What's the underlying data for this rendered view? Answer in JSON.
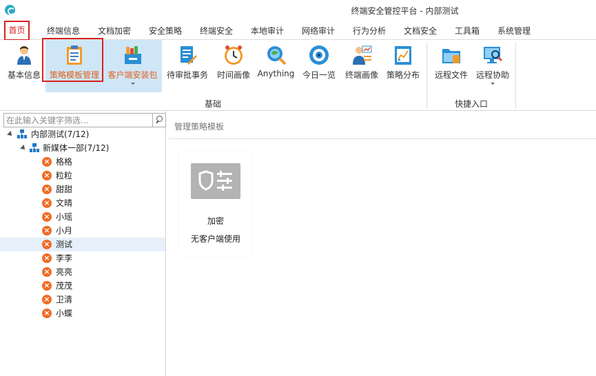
{
  "window": {
    "title": "终端安全管控平台 - 内部测试"
  },
  "menu": {
    "tabs": [
      {
        "label": "首页"
      },
      {
        "label": "终端信息"
      },
      {
        "label": "文档加密"
      },
      {
        "label": "安全策略"
      },
      {
        "label": "终端安全"
      },
      {
        "label": "本地审计"
      },
      {
        "label": "网络审计"
      },
      {
        "label": "行为分析"
      },
      {
        "label": "文档安全"
      },
      {
        "label": "工具箱"
      },
      {
        "label": "系统管理"
      }
    ]
  },
  "ribbon": {
    "buttons": [
      {
        "label": "基本信息",
        "icon": "user-icon"
      },
      {
        "label": "策略模板管理",
        "icon": "clipboard-icon"
      },
      {
        "label": "客户端安装包",
        "icon": "package-icon"
      },
      {
        "label": "待审批事务",
        "icon": "approval-icon"
      },
      {
        "label": "时间画像",
        "icon": "clock-icon"
      },
      {
        "label": "Anything",
        "icon": "search-globe-icon"
      },
      {
        "label": "今日一览",
        "icon": "eye-icon"
      },
      {
        "label": "终端画像",
        "icon": "terminal-profile-icon"
      },
      {
        "label": "策略分布",
        "icon": "chart-icon"
      },
      {
        "label": "远程文件",
        "icon": "folder-icon"
      },
      {
        "label": "远程协助",
        "icon": "remote-assist-icon"
      }
    ],
    "groups": {
      "basic": "基础",
      "quick": "快捷入口"
    }
  },
  "search": {
    "placeholder": "在此输入关键字筛选..."
  },
  "tree": {
    "root": "内部测试(7/12)",
    "dept": "新媒体一部(7/12)",
    "users": [
      "格格",
      "粒粒",
      "甜甜",
      "文晴",
      "小瑶",
      "小月",
      "测试",
      "李李",
      "亮亮",
      "茂茂",
      "卫清",
      "小蝶"
    ],
    "selected": "测试"
  },
  "main": {
    "breadcrumb": "管理策略模板",
    "card": {
      "title": "加密",
      "subtitle": "无客户端使用",
      "icon": "shield-list-icon"
    }
  },
  "colors": {
    "accent_red": "#d9201f",
    "selected_bg": "#cfe6f7",
    "selected_text": "#e0601c",
    "offline_orange": "#ef6c27",
    "org_blue": "#1e78c8"
  }
}
